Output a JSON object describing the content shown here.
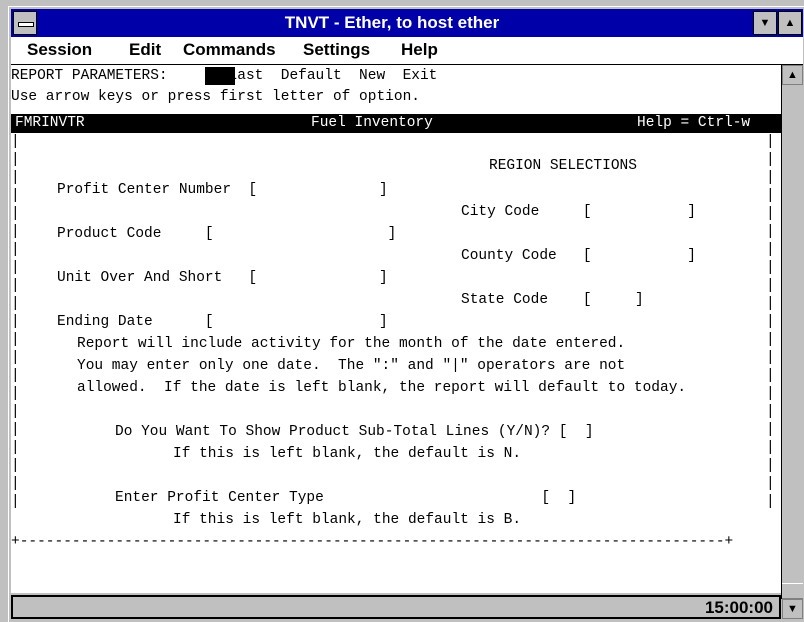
{
  "window": {
    "title": "TNVT - Ether, to host ether"
  },
  "menu": [
    "Session",
    "Edit",
    "Commands",
    "Settings",
    "Help"
  ],
  "terminal": {
    "line1": "REPORT PARAMETERS:       Last  Default  New  Exit",
    "line2": "Use arrow keys or press first letter of option.",
    "header_left": "FMRINVTR",
    "header_center": "Fuel Inventory",
    "header_right": "Help = Ctrl-w",
    "region_title": "REGION SELECTIONS",
    "profit_center": "Profit Center Number  [              ]",
    "city_code": "City Code     [           ]",
    "product_code": "Product Code     [                    ]",
    "county_code": "County Code   [           ]",
    "unit_over": "Unit Over And Short   [              ]",
    "state_code": "State Code    [     ]",
    "ending_date": "Ending Date      [                   ]",
    "note1": "Report will include activity for the month of the date entered.",
    "note2": "You may enter only one date.  The \":\" and \"|\" operators are not",
    "note3": "allowed.  If the date is left blank, the report will default to today.",
    "subtotal_q": "Do You Want To Show Product Sub-Total Lines (Y/N)? [  ]",
    "subtotal_hint": "If this is left blank, the default is N.",
    "pc_type_q": "Enter Profit Center Type                         [  ]",
    "pc_type_hint": "If this is left blank, the default is B."
  },
  "status": {
    "clock": "15:00:00"
  }
}
